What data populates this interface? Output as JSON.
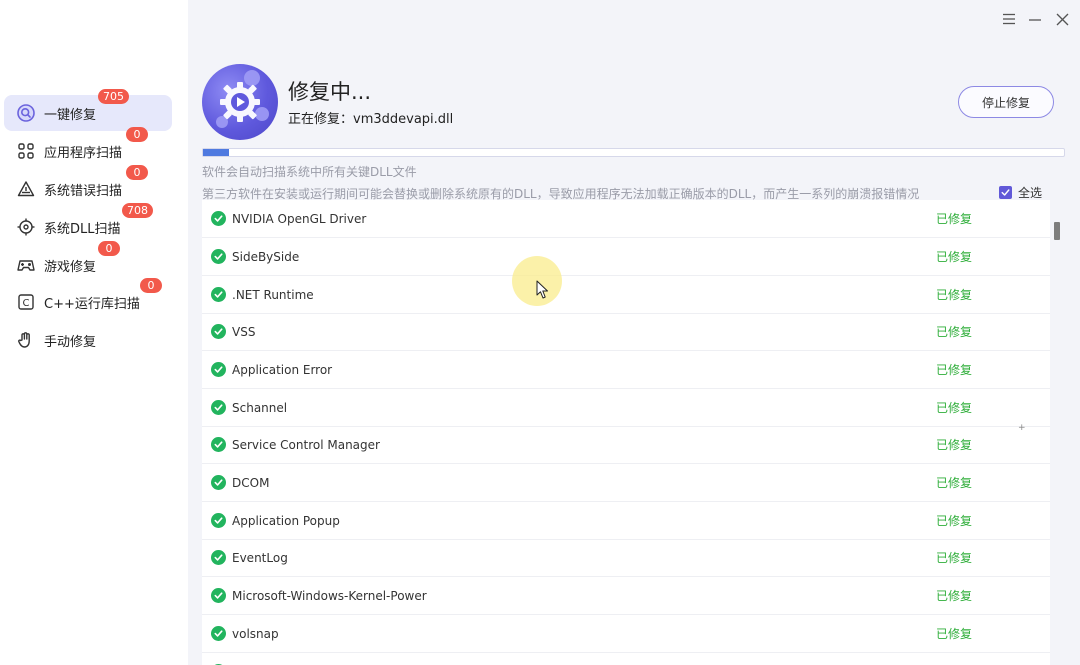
{
  "sidebar": {
    "items": [
      {
        "label": "一键修复",
        "badge": "705",
        "icon": "magnifier-icon",
        "active": true
      },
      {
        "label": "应用程序扫描",
        "badge": "0",
        "icon": "apps-icon"
      },
      {
        "label": "系统错误扫描",
        "badge": "0",
        "icon": "warning-icon"
      },
      {
        "label": "系统DLL扫描",
        "badge": "708",
        "icon": "target-icon"
      },
      {
        "label": "游戏修复",
        "badge": "0",
        "icon": "gamepad-icon"
      },
      {
        "label": "C++运行库扫描",
        "badge": "0",
        "icon": "cpp-icon"
      },
      {
        "label": "手动修复",
        "icon": "hand-icon"
      }
    ]
  },
  "window": {
    "menu_icon": "menu-icon",
    "minimize_icon": "minimize-icon",
    "close_icon": "close-icon"
  },
  "header": {
    "title": "修复中...",
    "subtitle": "正在修复：vm3ddevapi.dll",
    "stop_button": "停止修复",
    "progress": 0.03
  },
  "info": {
    "line1": "软件会自动扫描系统中所有关键DLL文件",
    "line2": "第三方软件在安装或运行期间可能会替换或删除系统原有的DLL，导致应用程序无法加载正确版本的DLL，而产生一系列的崩溃报错情况"
  },
  "select_all": {
    "label": "全选",
    "checked": true
  },
  "list": {
    "items": [
      {
        "name": "NVIDIA OpenGL Driver",
        "status": "已修复"
      },
      {
        "name": "SideBySide",
        "status": "已修复"
      },
      {
        "name": ".NET Runtime",
        "status": "已修复"
      },
      {
        "name": "VSS",
        "status": "已修复"
      },
      {
        "name": "Application Error",
        "status": "已修复"
      },
      {
        "name": "Schannel",
        "status": "已修复"
      },
      {
        "name": "Service Control Manager",
        "status": "已修复"
      },
      {
        "name": "DCOM",
        "status": "已修复"
      },
      {
        "name": "Application Popup",
        "status": "已修复"
      },
      {
        "name": "EventLog",
        "status": "已修复"
      },
      {
        "name": "Microsoft-Windows-Kernel-Power",
        "status": "已修复"
      },
      {
        "name": "volsnap",
        "status": "已修复"
      },
      {
        "name": "",
        "status": ""
      }
    ]
  },
  "colors": {
    "accent": "#6159d8",
    "badge": "#f2594b",
    "success": "#22b45e",
    "status_text": "#2fae3a"
  }
}
